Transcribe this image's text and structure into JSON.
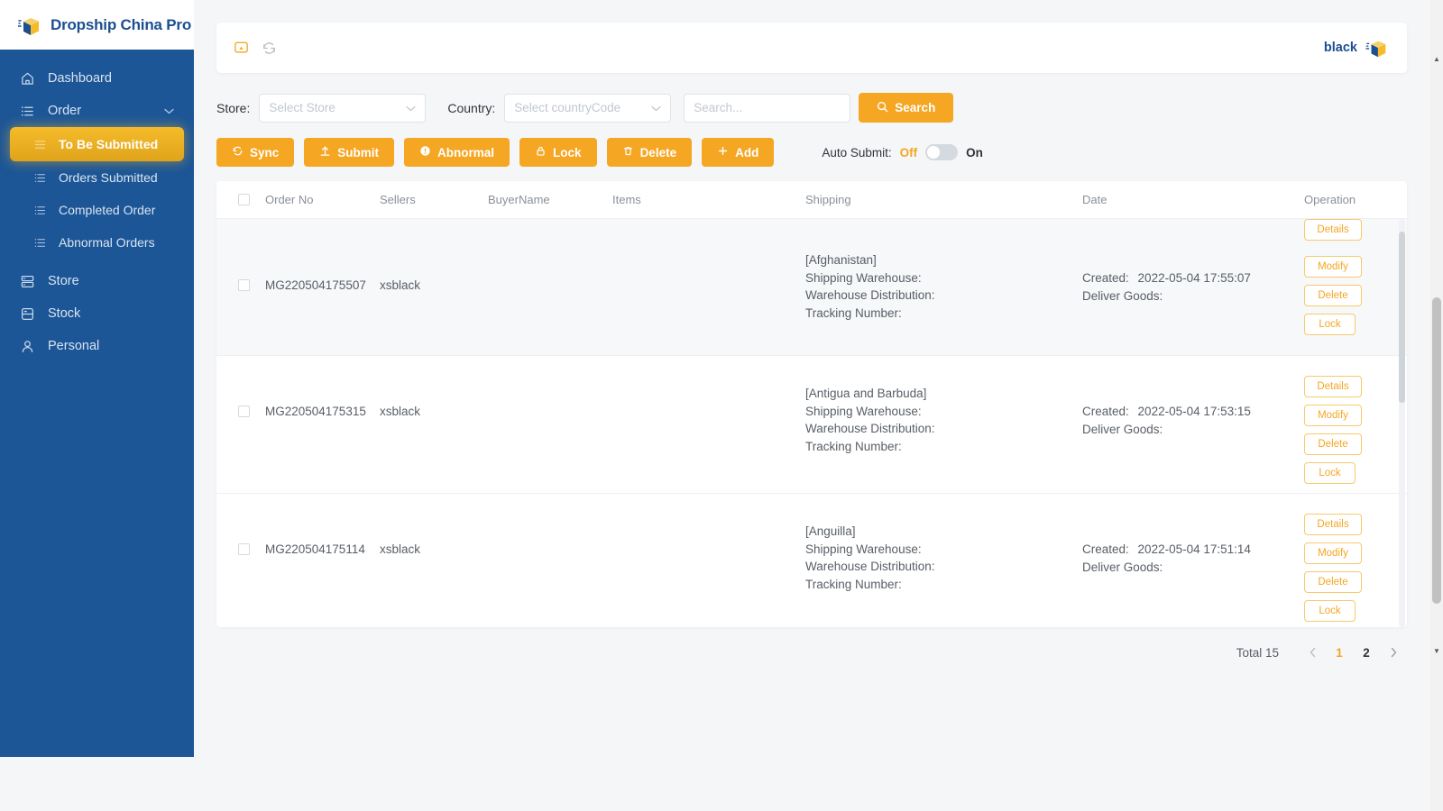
{
  "app": {
    "brand": "Dropship China Pro",
    "logo_icon": "box-package-icon"
  },
  "sidebar": {
    "items": [
      {
        "label": "Dashboard",
        "icon": "home-icon",
        "level": "top",
        "active": false
      },
      {
        "label": "Order",
        "icon": "list-icon",
        "level": "top",
        "active": false,
        "expandable": true
      },
      {
        "label": "To Be Submitted",
        "icon": "list-icon",
        "level": "sub",
        "active": true
      },
      {
        "label": "Orders Submitted",
        "icon": "list-icon",
        "level": "sub",
        "active": false
      },
      {
        "label": "Completed Order",
        "icon": "list-icon",
        "level": "sub",
        "active": false
      },
      {
        "label": "Abnormal Orders",
        "icon": "list-icon",
        "level": "sub",
        "active": false
      },
      {
        "label": "Store",
        "icon": "server-icon",
        "level": "top",
        "active": false
      },
      {
        "label": "Stock",
        "icon": "database-icon",
        "level": "top",
        "active": false
      },
      {
        "label": "Personal",
        "icon": "user-icon",
        "level": "top",
        "active": false
      }
    ]
  },
  "topbar": {
    "left_icons": [
      "screen-cast-icon",
      "refresh-icon"
    ],
    "username": "black",
    "avatar_icon": "box-package-icon"
  },
  "filters": {
    "store_label": "Store:",
    "store_placeholder": "Select Store",
    "country_label": "Country:",
    "country_placeholder": "Select countryCode",
    "search_placeholder": "Search...",
    "search_value": "",
    "search_button": "Search",
    "search_button_icon": "search-icon"
  },
  "actions": {
    "buttons": [
      {
        "label": "Sync",
        "icon": "refresh-icon"
      },
      {
        "label": "Submit",
        "icon": "upload-icon"
      },
      {
        "label": "Abnormal",
        "icon": "alert-icon"
      },
      {
        "label": "Lock",
        "icon": "lock-icon"
      },
      {
        "label": "Delete",
        "icon": "trash-icon"
      },
      {
        "label": "Add",
        "icon": "plus-icon"
      }
    ],
    "auto_submit_label": "Auto Submit:",
    "auto_submit_off": "Off",
    "auto_submit_on": "On",
    "auto_submit_state": "off"
  },
  "table": {
    "columns": [
      "Order No",
      "Sellers",
      "BuyerName",
      "Items",
      "Shipping",
      "Date",
      "Operation"
    ],
    "select_all_checked": false,
    "shipping_labels": {
      "warehouse": "Shipping Warehouse:",
      "distribution": "Warehouse Distribution:",
      "tracking": "Tracking Number:"
    },
    "date_labels": {
      "created": "Created:",
      "deliver": "Deliver Goods:"
    },
    "operation_buttons": [
      "Details",
      "Modify",
      "Delete",
      "Lock"
    ],
    "rows": [
      {
        "checked": false,
        "order_no": "MG220504175507",
        "sellers": "xsblack",
        "buyer_name": "",
        "items": "",
        "country": "[Afghanistan]",
        "shipping_warehouse": "",
        "warehouse_distribution": "",
        "tracking_number": "",
        "created": "2022-05-04 17:55:07",
        "deliver_goods": ""
      },
      {
        "checked": false,
        "order_no": "MG220504175315",
        "sellers": "xsblack",
        "buyer_name": "",
        "items": "",
        "country": "[Antigua and Barbuda]",
        "shipping_warehouse": "",
        "warehouse_distribution": "",
        "tracking_number": "",
        "created": "2022-05-04 17:53:15",
        "deliver_goods": ""
      },
      {
        "checked": false,
        "order_no": "MG220504175114",
        "sellers": "xsblack",
        "buyer_name": "",
        "items": "",
        "country": "[Anguilla]",
        "shipping_warehouse": "",
        "warehouse_distribution": "",
        "tracking_number": "",
        "created": "2022-05-04 17:51:14",
        "deliver_goods": ""
      }
    ]
  },
  "pagination": {
    "total_label": "Total 15",
    "prev_icon": "chevron-left-icon",
    "next_icon": "chevron-right-icon",
    "pages": [
      "1",
      "2"
    ],
    "current_page": "1"
  },
  "colors": {
    "sidebar_bg": "#1c5697",
    "accent": "#f5a623",
    "accent_active": "#f5bb2a",
    "brand_blue": "#1c4f91",
    "page_bg": "#f5f6f8"
  }
}
